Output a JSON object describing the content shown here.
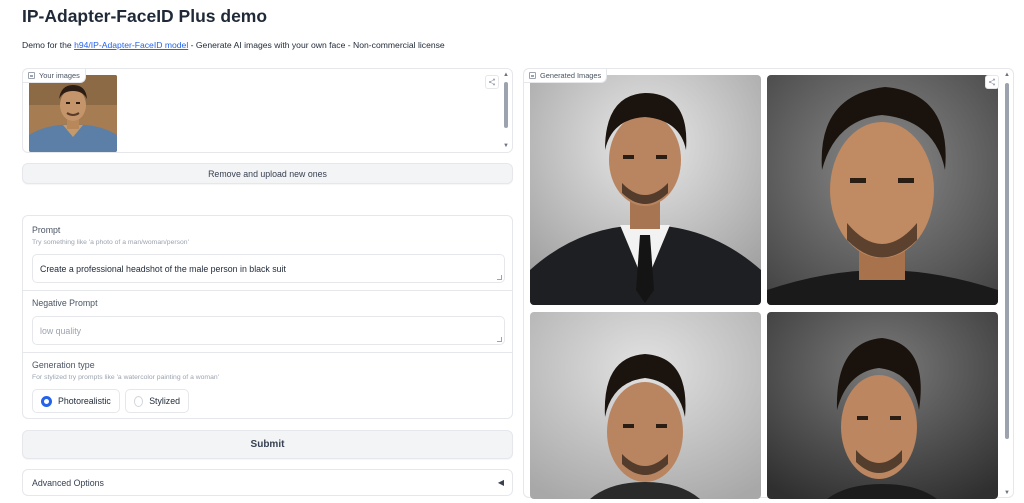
{
  "header": {
    "title": "IP-Adapter-FaceID Plus demo",
    "desc_before": "Demo for the ",
    "desc_link": "h94/IP-Adapter-FaceID model",
    "desc_after": " - Generate AI images with your own face - Non-commercial license"
  },
  "your_images": {
    "label": "Your images",
    "remove_button": "Remove and upload new ones"
  },
  "prompt": {
    "label": "Prompt",
    "info": "Try something like 'a photo of a man/woman/person'",
    "value": "Create a professional headshot of the male person in black suit"
  },
  "negative_prompt": {
    "label": "Negative Prompt",
    "placeholder": "low quality"
  },
  "generation_type": {
    "label": "Generation type",
    "info": "For stylized try prompts like 'a watercolor painting of a woman'",
    "options": [
      "Photorealistic",
      "Stylized"
    ],
    "selected": "Photorealistic"
  },
  "submit_button": "Submit",
  "advanced": {
    "label": "Advanced Options",
    "expanded": false
  },
  "gallery": {
    "label": "Generated Images",
    "images": [
      "man-in-black-suit-tie",
      "man-closeup-portrait",
      "man-portrait-gray-bg",
      "man-portrait-dark-bg"
    ]
  },
  "colors": {
    "accent": "#2563eb",
    "link": "#2563eb",
    "button_bg": "#f3f4f6",
    "border": "#e5e7eb"
  }
}
